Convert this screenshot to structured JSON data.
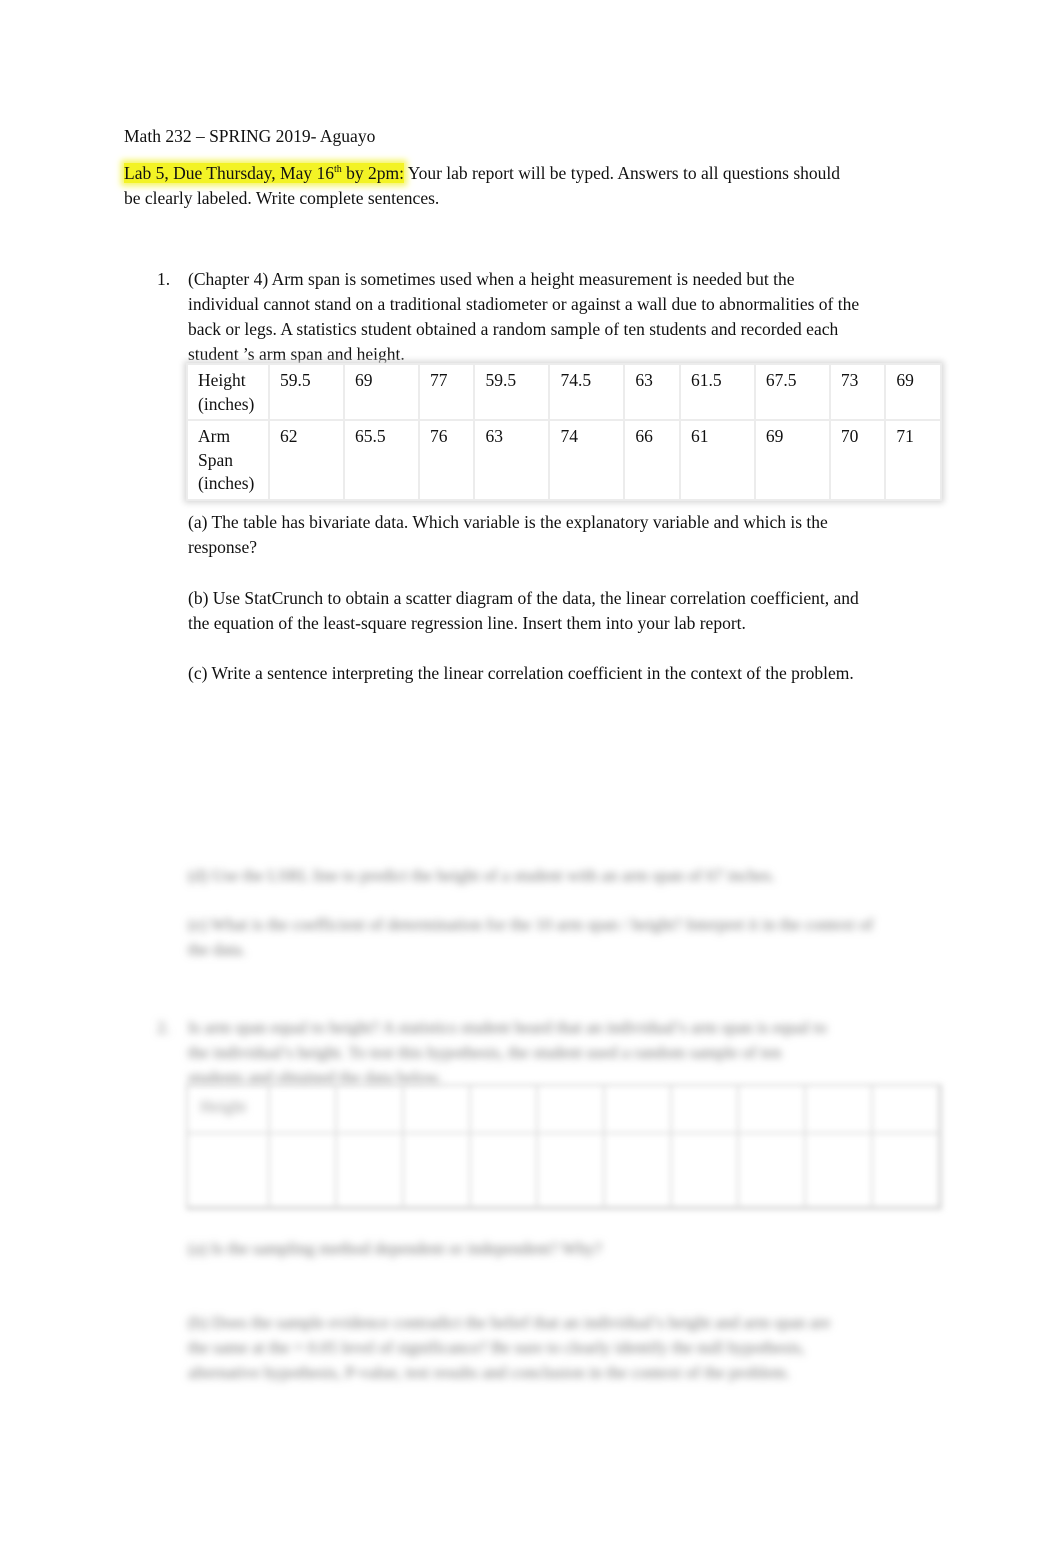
{
  "header": {
    "text": "Math 232  – SPRING 2019- Aguayo"
  },
  "intro": {
    "highlight_prefix": "Lab 5, Due Thursday, May 16",
    "highlight_sup": "th",
    "highlight_suffix": " by 2pm:",
    "line1_rest": " Your lab report will be typed. Answers to all questions should",
    "line2": "be clearly labeled. Write complete sentences.",
    "highlight_color": "#f3f325"
  },
  "question1": {
    "number": "1.",
    "lines": [
      "(Chapter 4)  Arm span is sometimes used when a height measurement is needed but the",
      "individual cannot stand on a traditional stadiometer or against a wall due to abnormalities of the",
      "back or legs.  A statistics student obtained a random sample of ten students and recorded each",
      "student ’s arm span and height."
    ],
    "table": {
      "rows": [
        {
          "label_lines": [
            "Height",
            "(inches)"
          ],
          "values": [
            "59.5",
            "69",
            "77",
            "59.5",
            "74.5",
            "63",
            "61.5",
            "67.5",
            "73",
            "69"
          ]
        },
        {
          "label_lines": [
            "Arm",
            "Span",
            "(inches)"
          ],
          "values": [
            "62",
            "65.5",
            "76",
            "63",
            "74",
            "66",
            "61",
            "69",
            "70",
            "71"
          ]
        }
      ]
    },
    "parts": {
      "a": [
        "(a) The table has bivariate data. Which variable is the explanatory variable and which is the",
        "response?"
      ],
      "b": [
        "(b) Use StatCrunch to obtain a scatter diagram of the data, the linear correlation coefficient, and",
        "the equation of the least-square regression line. Insert them into your lab report."
      ],
      "c": [
        "(c) Write a sentence interpreting the linear correlation coefficient in the context of the problem."
      ]
    }
  },
  "blurred": {
    "note": "remaining content obscured",
    "d": "(d) Use the LSRL line to predict the height of a student with an arm span of 67 inches.",
    "e1": "(e) What is the coefficient of determination for the 10 arm span / height? Interpret it in the context of",
    "e2": "the data.",
    "q2_num": "2.",
    "q2_1": "Is arm span equal to height?  A statistics student heard that an individual’s arm span is equal to",
    "q2_2": "the individual’s height. To test this hypothesis, the student used a random sample of ten",
    "q2_3": "students and obtained the data below.",
    "q2a": "(a) Is the sampling method dependent or independent? Why?",
    "q2b1": "(b) Does the sample evidence contradict the belief that an individual’s height and arm span are",
    "q2b2": "the same at the       = 0.05 level of significance? Be sure to clearly identify the null hypothesis,",
    "q2b3": "alternative hypothesis, P-value, test results and conclusion in the context of the problem."
  }
}
